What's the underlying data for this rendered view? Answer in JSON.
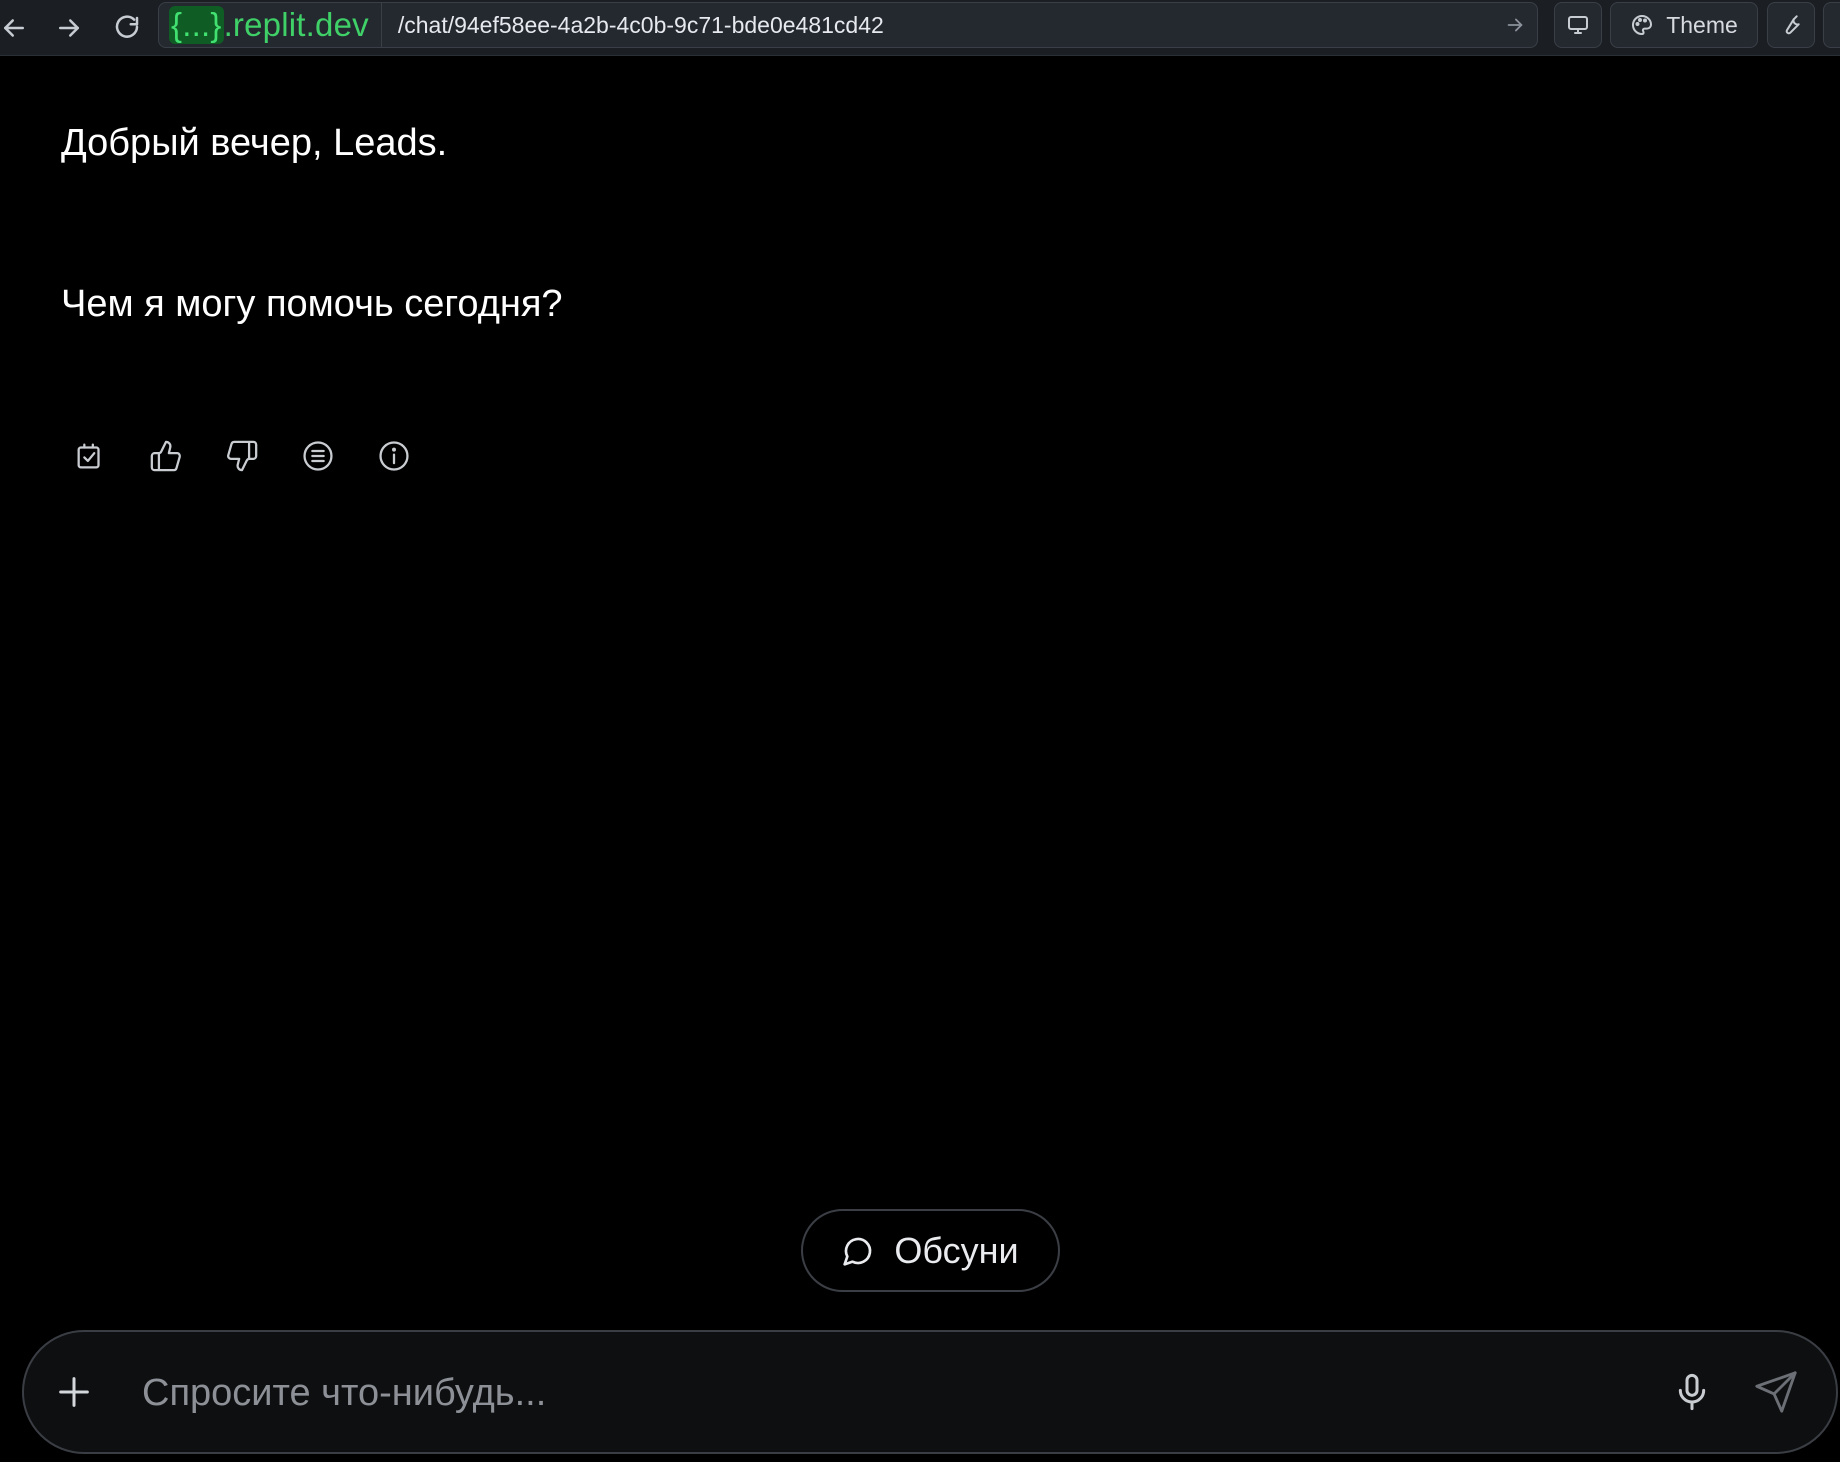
{
  "browser": {
    "url_host_brace": "{...}",
    "url_host_domain": ".replit.dev",
    "url_path": "/chat/94ef58ee-4a2b-4c0b-9c71-bde0e481cd42",
    "theme_label": "Theme",
    "icons": [
      "back-arrow-icon",
      "forward-arrow-icon",
      "reload-icon",
      "go-arrow-icon",
      "monitor-icon",
      "palette-icon",
      "wrench-icon"
    ]
  },
  "chat": {
    "greeting": "Добрый вечер, Leads.",
    "help_prompt": "Чем я могу помочь сегодня?",
    "message_actions": [
      "copy-check-icon",
      "thumbs-up-icon",
      "thumbs-down-icon",
      "list-circle-icon",
      "info-icon"
    ]
  },
  "discuss": {
    "label": "Обсуни",
    "icon": "chat-bubble-icon"
  },
  "composer": {
    "placeholder": "Спросите что-нибудь...",
    "value": "",
    "icons": [
      "plus-icon",
      "microphone-icon",
      "send-icon"
    ]
  },
  "colors": {
    "background": "#000000",
    "toolbar": "#1b1f24",
    "host_green": "#3fd168",
    "composer_bg": "#0e0f10",
    "border": "#3a3e44"
  }
}
